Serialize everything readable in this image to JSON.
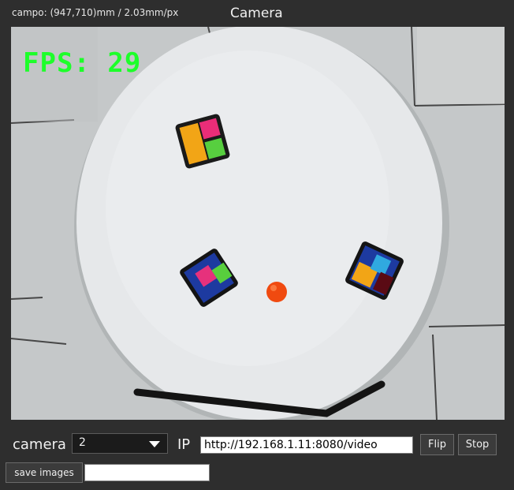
{
  "header": {
    "campo_info": "campo: (947,710)mm / 2.03mm/px",
    "title": "Camera"
  },
  "video": {
    "fps_text": "FPS: 29"
  },
  "controls": {
    "camera_label": "camera",
    "camera_value": "2",
    "ip_label": "IP",
    "ip_value": "http://192.168.1.11:8080/video",
    "flip_label": "Flip",
    "stop_label": "Stop",
    "save_images_label": "save images",
    "save_path_value": ""
  },
  "colors": {
    "fps_text": "#1dff2a",
    "background": "#2e2e2e"
  }
}
